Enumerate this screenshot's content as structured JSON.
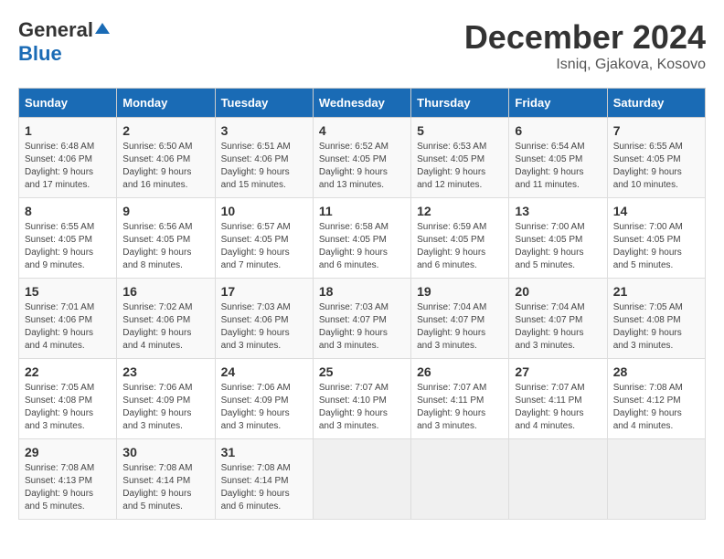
{
  "header": {
    "logo_general": "General",
    "logo_blue": "Blue",
    "title": "December 2024",
    "location": "Isniq, Gjakova, Kosovo"
  },
  "weekdays": [
    "Sunday",
    "Monday",
    "Tuesday",
    "Wednesday",
    "Thursday",
    "Friday",
    "Saturday"
  ],
  "weeks": [
    [
      {
        "day": "1",
        "sunrise": "6:48 AM",
        "sunset": "4:06 PM",
        "daylight": "9 hours and 17 minutes."
      },
      {
        "day": "2",
        "sunrise": "6:50 AM",
        "sunset": "4:06 PM",
        "daylight": "9 hours and 16 minutes."
      },
      {
        "day": "3",
        "sunrise": "6:51 AM",
        "sunset": "4:06 PM",
        "daylight": "9 hours and 15 minutes."
      },
      {
        "day": "4",
        "sunrise": "6:52 AM",
        "sunset": "4:05 PM",
        "daylight": "9 hours and 13 minutes."
      },
      {
        "day": "5",
        "sunrise": "6:53 AM",
        "sunset": "4:05 PM",
        "daylight": "9 hours and 12 minutes."
      },
      {
        "day": "6",
        "sunrise": "6:54 AM",
        "sunset": "4:05 PM",
        "daylight": "9 hours and 11 minutes."
      },
      {
        "day": "7",
        "sunrise": "6:55 AM",
        "sunset": "4:05 PM",
        "daylight": "9 hours and 10 minutes."
      }
    ],
    [
      {
        "day": "8",
        "sunrise": "6:55 AM",
        "sunset": "4:05 PM",
        "daylight": "9 hours and 9 minutes."
      },
      {
        "day": "9",
        "sunrise": "6:56 AM",
        "sunset": "4:05 PM",
        "daylight": "9 hours and 8 minutes."
      },
      {
        "day": "10",
        "sunrise": "6:57 AM",
        "sunset": "4:05 PM",
        "daylight": "9 hours and 7 minutes."
      },
      {
        "day": "11",
        "sunrise": "6:58 AM",
        "sunset": "4:05 PM",
        "daylight": "9 hours and 6 minutes."
      },
      {
        "day": "12",
        "sunrise": "6:59 AM",
        "sunset": "4:05 PM",
        "daylight": "9 hours and 6 minutes."
      },
      {
        "day": "13",
        "sunrise": "7:00 AM",
        "sunset": "4:05 PM",
        "daylight": "9 hours and 5 minutes."
      },
      {
        "day": "14",
        "sunrise": "7:00 AM",
        "sunset": "4:05 PM",
        "daylight": "9 hours and 5 minutes."
      }
    ],
    [
      {
        "day": "15",
        "sunrise": "7:01 AM",
        "sunset": "4:06 PM",
        "daylight": "9 hours and 4 minutes."
      },
      {
        "day": "16",
        "sunrise": "7:02 AM",
        "sunset": "4:06 PM",
        "daylight": "9 hours and 4 minutes."
      },
      {
        "day": "17",
        "sunrise": "7:03 AM",
        "sunset": "4:06 PM",
        "daylight": "9 hours and 3 minutes."
      },
      {
        "day": "18",
        "sunrise": "7:03 AM",
        "sunset": "4:07 PM",
        "daylight": "9 hours and 3 minutes."
      },
      {
        "day": "19",
        "sunrise": "7:04 AM",
        "sunset": "4:07 PM",
        "daylight": "9 hours and 3 minutes."
      },
      {
        "day": "20",
        "sunrise": "7:04 AM",
        "sunset": "4:07 PM",
        "daylight": "9 hours and 3 minutes."
      },
      {
        "day": "21",
        "sunrise": "7:05 AM",
        "sunset": "4:08 PM",
        "daylight": "9 hours and 3 minutes."
      }
    ],
    [
      {
        "day": "22",
        "sunrise": "7:05 AM",
        "sunset": "4:08 PM",
        "daylight": "9 hours and 3 minutes."
      },
      {
        "day": "23",
        "sunrise": "7:06 AM",
        "sunset": "4:09 PM",
        "daylight": "9 hours and 3 minutes."
      },
      {
        "day": "24",
        "sunrise": "7:06 AM",
        "sunset": "4:09 PM",
        "daylight": "9 hours and 3 minutes."
      },
      {
        "day": "25",
        "sunrise": "7:07 AM",
        "sunset": "4:10 PM",
        "daylight": "9 hours and 3 minutes."
      },
      {
        "day": "26",
        "sunrise": "7:07 AM",
        "sunset": "4:11 PM",
        "daylight": "9 hours and 3 minutes."
      },
      {
        "day": "27",
        "sunrise": "7:07 AM",
        "sunset": "4:11 PM",
        "daylight": "9 hours and 4 minutes."
      },
      {
        "day": "28",
        "sunrise": "7:08 AM",
        "sunset": "4:12 PM",
        "daylight": "9 hours and 4 minutes."
      }
    ],
    [
      {
        "day": "29",
        "sunrise": "7:08 AM",
        "sunset": "4:13 PM",
        "daylight": "9 hours and 5 minutes."
      },
      {
        "day": "30",
        "sunrise": "7:08 AM",
        "sunset": "4:14 PM",
        "daylight": "9 hours and 5 minutes."
      },
      {
        "day": "31",
        "sunrise": "7:08 AM",
        "sunset": "4:14 PM",
        "daylight": "9 hours and 6 minutes."
      },
      null,
      null,
      null,
      null
    ]
  ]
}
